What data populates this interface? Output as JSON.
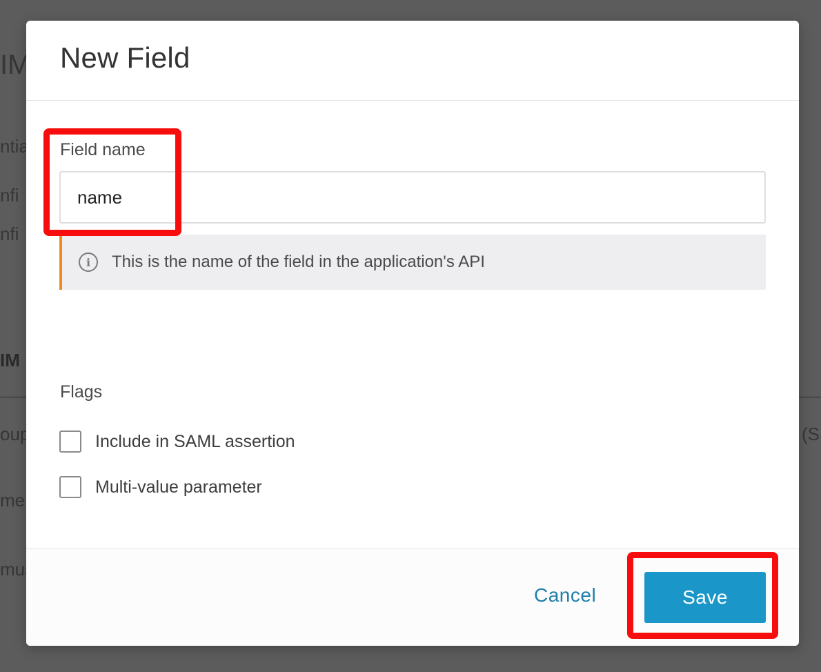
{
  "background": {
    "fragments": [
      "IM",
      "ntia",
      "nfi",
      "nfi",
      "IM",
      "oups",
      "(S",
      "me",
      "mus"
    ]
  },
  "modal": {
    "title": "New Field",
    "field_name": {
      "label": "Field name",
      "value": "name"
    },
    "info": {
      "icon": "info-icon",
      "text": "This is the name of the field in the application's API"
    },
    "flags": {
      "heading": "Flags",
      "options": [
        {
          "label": "Include in SAML assertion",
          "checked": false
        },
        {
          "label": "Multi-value parameter",
          "checked": false
        }
      ]
    },
    "footer": {
      "cancel_label": "Cancel",
      "save_label": "Save"
    }
  },
  "colors": {
    "accent": "#1b96c8",
    "link": "#1d7faa",
    "info_border": "#f08c1c",
    "highlight": "#f70d0d"
  }
}
